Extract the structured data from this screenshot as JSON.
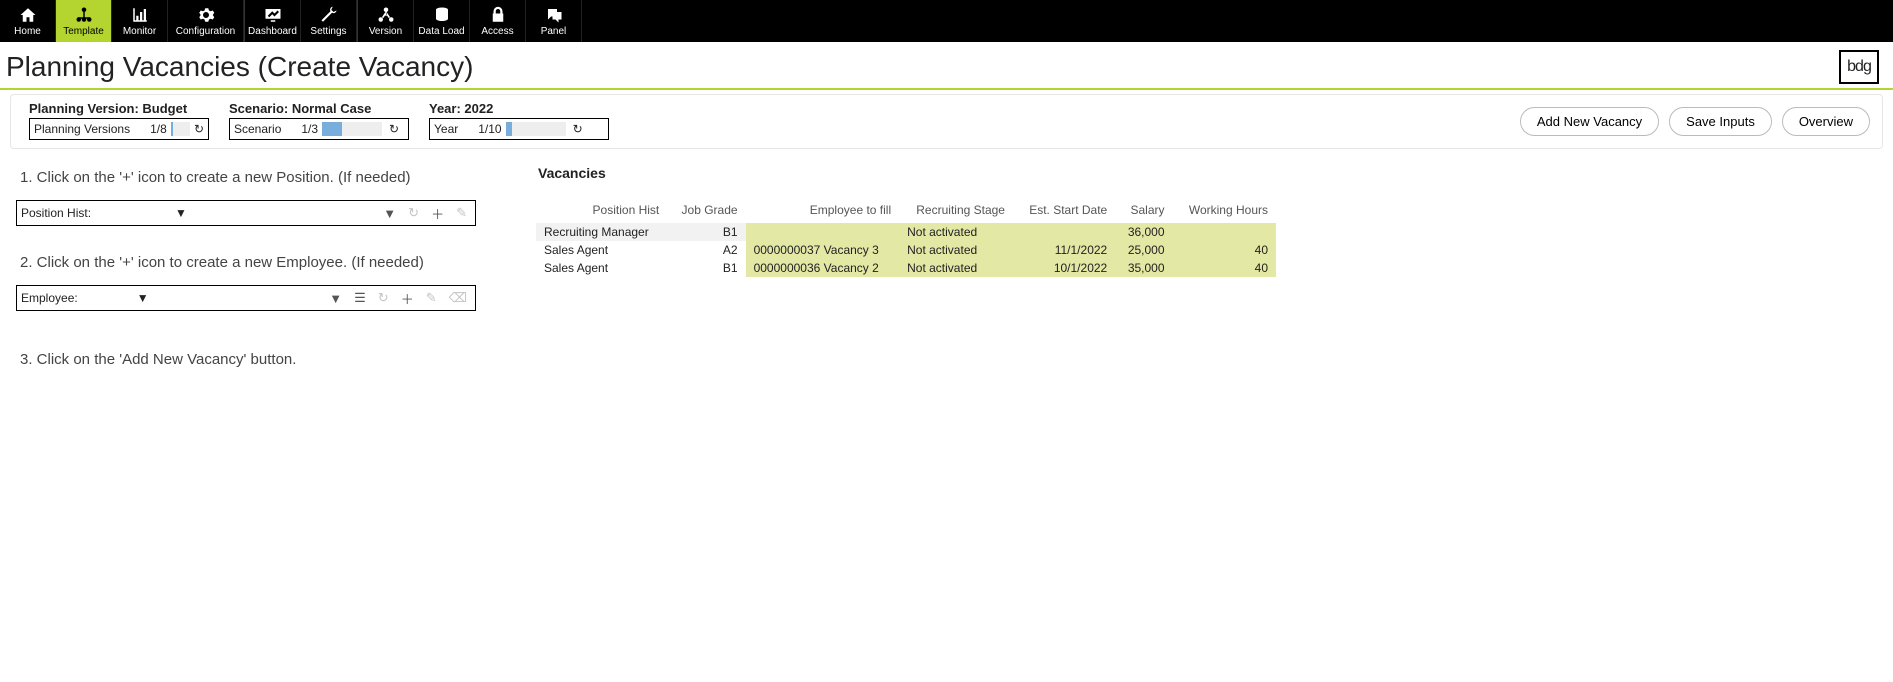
{
  "nav": {
    "items": [
      {
        "id": "home",
        "label": "Home"
      },
      {
        "id": "template",
        "label": "Template"
      },
      {
        "id": "monitor",
        "label": "Monitor"
      },
      {
        "id": "configuration",
        "label": "Configuration"
      },
      {
        "id": "dashboard",
        "label": "Dashboard"
      },
      {
        "id": "settings",
        "label": "Settings"
      },
      {
        "id": "version",
        "label": "Version"
      },
      {
        "id": "dataload",
        "label": "Data Load"
      },
      {
        "id": "access",
        "label": "Access"
      },
      {
        "id": "panel",
        "label": "Panel"
      }
    ],
    "active": "template"
  },
  "page": {
    "title": "Planning Vacancies (Create Vacancy)",
    "logo": "bdg"
  },
  "filters": {
    "version": {
      "label": "Planning Version: Budget",
      "name": "Planning Versions",
      "count": "1/8",
      "fill_pct": 12
    },
    "scenario": {
      "label": "Scenario: Normal Case",
      "name": "Scenario",
      "count": "1/3",
      "fill_pct": 33
    },
    "year": {
      "label": "Year: 2022",
      "name": "Year",
      "count": "1/10",
      "fill_pct": 10
    }
  },
  "buttons": {
    "add_vacancy": "Add New Vacancy",
    "save_inputs": "Save Inputs",
    "overview": "Overview"
  },
  "left": {
    "instr1": "1. Click on the '+' icon to create a new Position. (If needed)",
    "instr2": "2. Click on the '+' icon to create a new Employee. (If needed)",
    "instr3": "3. Click on the 'Add New Vacancy' button.",
    "position_label": "Position Hist:",
    "employee_label": "Employee:"
  },
  "vacancies": {
    "title": "Vacancies",
    "headers": {
      "position": "Position Hist",
      "grade": "Job Grade",
      "employee": "Employee to fill",
      "stage": "Recruiting Stage",
      "start": "Est. Start Date",
      "salary": "Salary",
      "hours": "Working Hours"
    },
    "rows": [
      {
        "position": "Recruiting Manager",
        "grade": "B1",
        "employee": "",
        "stage": "Not activated",
        "start": "",
        "salary": "36,000",
        "hours": ""
      },
      {
        "position": "Sales Agent",
        "grade": "A2",
        "employee": "0000000037 Vacancy 3",
        "stage": "Not activated",
        "start": "11/1/2022",
        "salary": "25,000",
        "hours": "40"
      },
      {
        "position": "Sales Agent",
        "grade": "B1",
        "employee": "0000000036 Vacancy 2",
        "stage": "Not activated",
        "start": "10/1/2022",
        "salary": "35,000",
        "hours": "40"
      }
    ]
  }
}
